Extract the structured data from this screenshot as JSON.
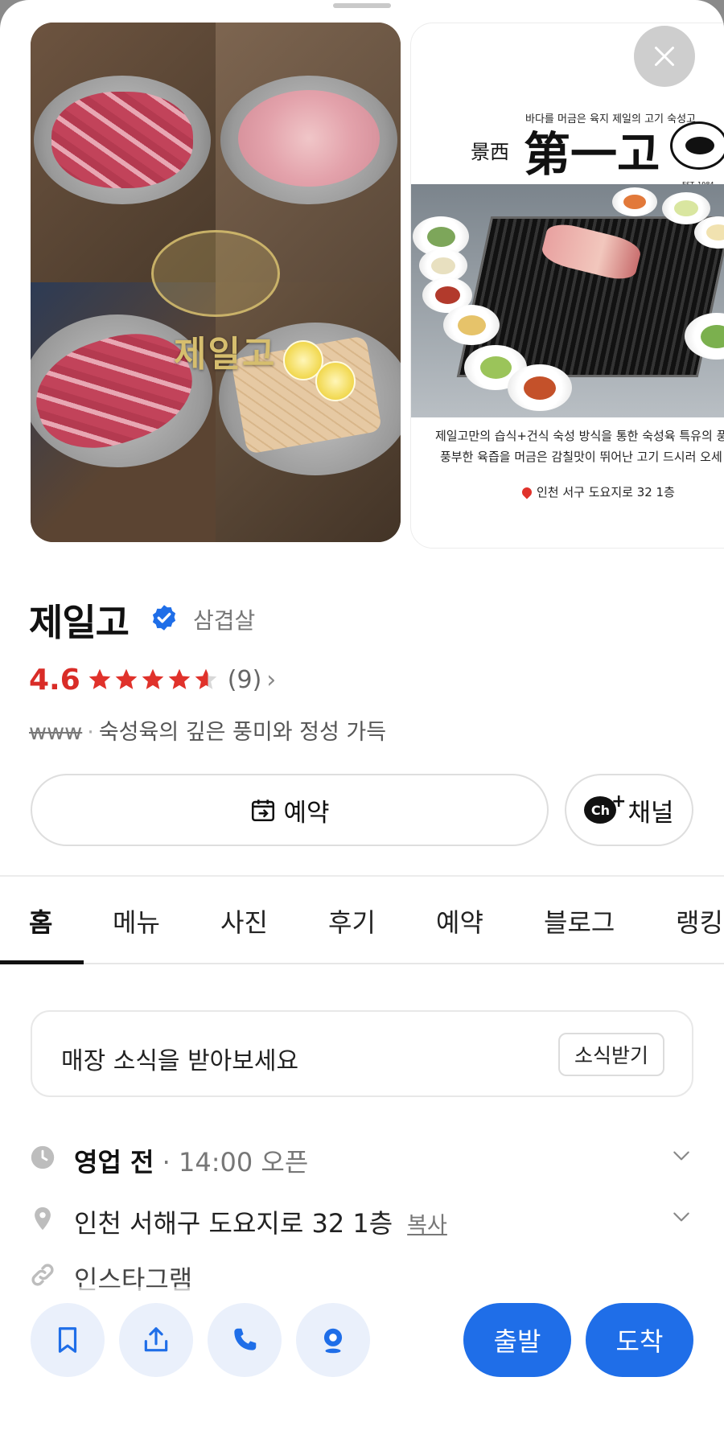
{
  "photos": {
    "photo1_logo_text": "제일고",
    "photo2": {
      "tagline": "바다를 머금은 육지 제일의 고기 숙성고",
      "brand_small": "景西",
      "brand_big": "第一고",
      "seal_text": "EST. 1984",
      "desc_line1": "제일고만의 습식+건식 숙성 방식을 통한 숙성육 특유의 풍",
      "desc_line2": "풍부한 육즙을 머금은 감칠맛이 뛰어난 고기 드시러 오세",
      "address": "인천 서구 도요지로 32 1층"
    },
    "close_icon": "close-icon"
  },
  "place": {
    "name": "제일고",
    "category": "삼겹살",
    "rating": "4.6",
    "review_count": "(9)",
    "website": "www",
    "description": "숙성육의 깊은 풍미와 정성 가득"
  },
  "actions": {
    "reserve_label": "예약",
    "channel_label": "채널",
    "channel_icon_text": "Ch"
  },
  "tabs": [
    {
      "label": "홈"
    },
    {
      "label": "메뉴"
    },
    {
      "label": "사진"
    },
    {
      "label": "후기"
    },
    {
      "label": "예약"
    },
    {
      "label": "블로그"
    },
    {
      "label": "랭킹"
    }
  ],
  "news": {
    "text": "매장 소식을 받아보세요",
    "button": "소식받기"
  },
  "info": {
    "status": "영업 전",
    "hours": "14:00 오픈",
    "address": "인천 서해구 도요지로 32 1층",
    "copy": "복사",
    "link": "인스타그램"
  },
  "bottom": {
    "depart": "출발",
    "arrive": "도착"
  },
  "colors": {
    "accent_blue": "#1f6ee8",
    "rating_red": "#d92c27",
    "star_red": "#e0322b"
  }
}
